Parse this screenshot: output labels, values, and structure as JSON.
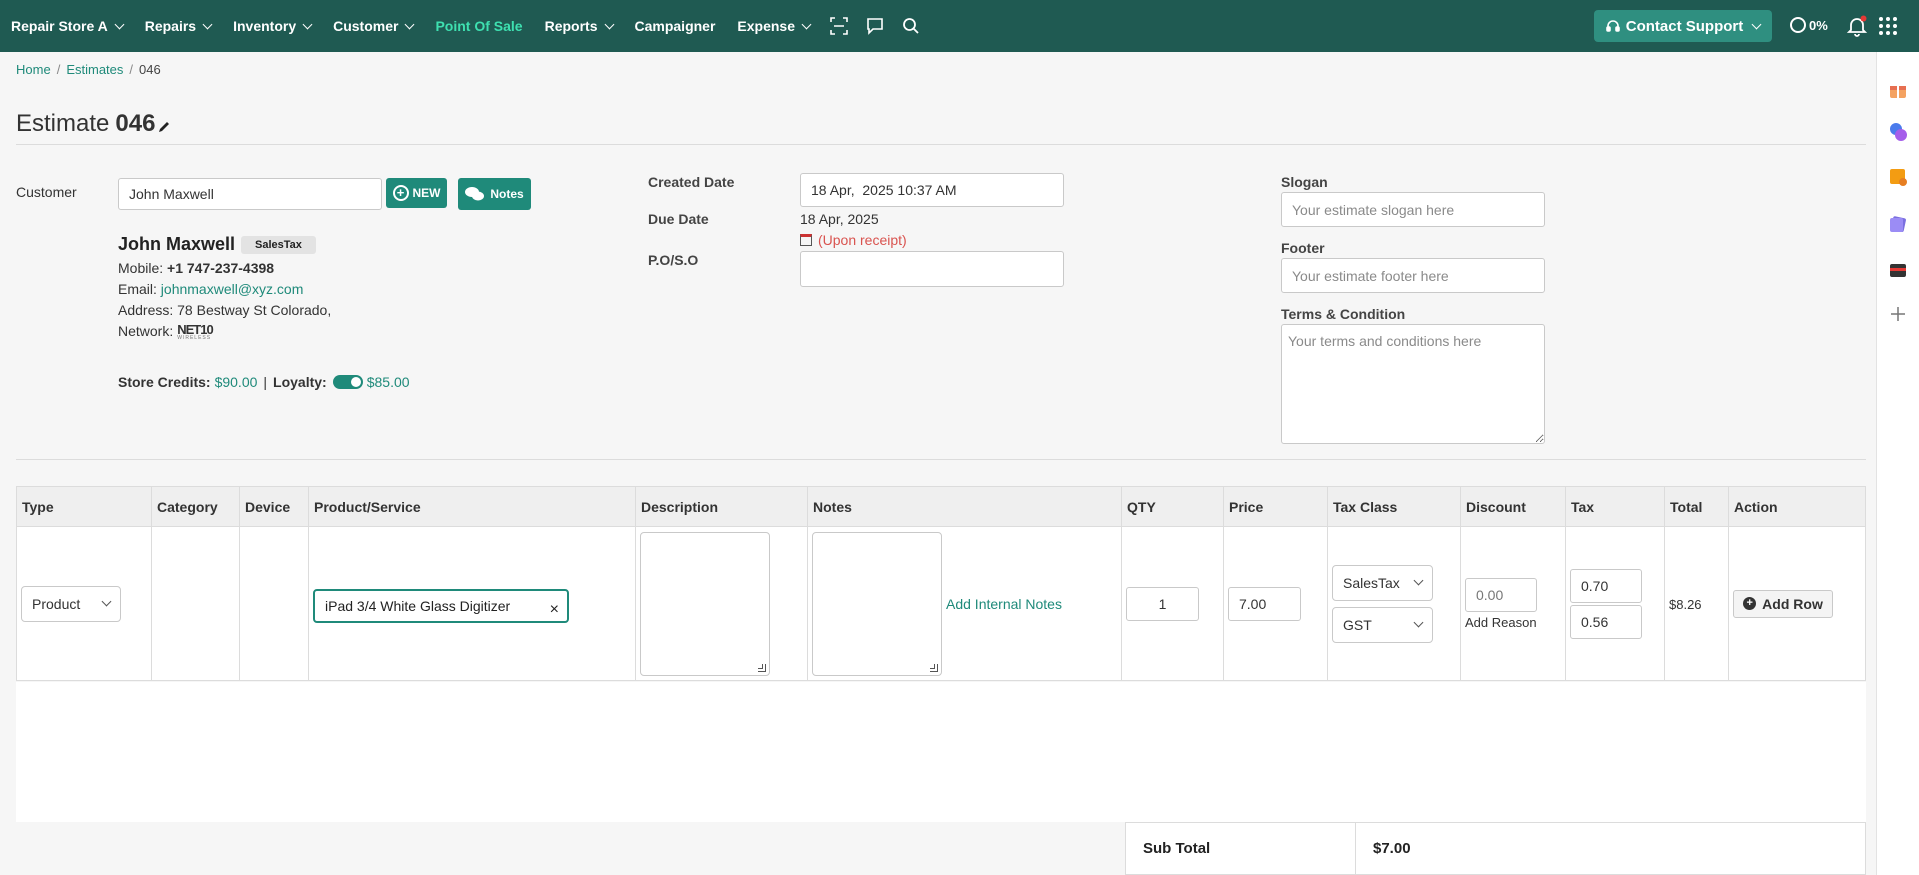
{
  "topnav": {
    "items": [
      {
        "label": "Repair Store A",
        "dropdown": true
      },
      {
        "label": "Repairs",
        "dropdown": true
      },
      {
        "label": "Inventory",
        "dropdown": true
      },
      {
        "label": "Customer",
        "dropdown": true
      },
      {
        "label": "Point Of Sale",
        "dropdown": false,
        "active": true
      },
      {
        "label": "Reports",
        "dropdown": true
      },
      {
        "label": "Campaigner",
        "dropdown": false
      },
      {
        "label": "Expense",
        "dropdown": true
      }
    ],
    "support_label": "Contact Support",
    "progress_label": "0%",
    "colors": {
      "bar": "#1f5a52",
      "accent": "#1f8a7a",
      "active": "#3ee0b0"
    }
  },
  "breadcrumb": {
    "home": "Home",
    "estimates": "Estimates",
    "current": "046"
  },
  "page": {
    "title": "Estimate",
    "number": "046"
  },
  "customer": {
    "label": "Customer",
    "input_value": "John Maxwell",
    "new_label": "NEW",
    "notes_label": "Notes",
    "name": "John Maxwell",
    "tax_badge": "SalesTax",
    "mobile_label": "Mobile:",
    "mobile": "+1 747-237-4398",
    "email_label": "Email:",
    "email": "johnmaxwell@xyz.com",
    "address_label": "Address:",
    "address": "78 Bestway St Colorado,",
    "network_label": "Network:",
    "network_logo": "NET10",
    "network_logo_sub": "WIRELESS",
    "store_credits_label": "Store Credits:",
    "store_credits": "$90.00",
    "loyalty_label": "Loyalty:",
    "loyalty": "$85.00"
  },
  "dates": {
    "created_label": "Created Date",
    "created_value": "18 Apr,  2025 10:37 AM",
    "due_label": "Due Date",
    "due_value": "18 Apr, 2025",
    "due_note": "(Upon receipt)",
    "po_label": "P.O/S.O",
    "po_value": ""
  },
  "extras": {
    "slogan_label": "Slogan",
    "slogan_placeholder": "Your estimate slogan here",
    "footer_label": "Footer",
    "footer_placeholder": "Your estimate footer here",
    "terms_label": "Terms & Condition",
    "terms_placeholder": "Your terms and conditions here"
  },
  "table": {
    "headers": [
      "Type",
      "Category",
      "Device",
      "Product/Service",
      "Description",
      "Notes",
      "QTY",
      "Price",
      "Tax Class",
      "Discount",
      "Tax",
      "Total",
      "Action"
    ],
    "row": {
      "type": "Product",
      "product": "iPad 3/4 White Glass Digitizer",
      "internal_notes_link": "Add Internal Notes",
      "qty": "1",
      "price": "7.00",
      "tax_class_1": "SalesTax",
      "tax_class_2": "GST",
      "discount": "0.00",
      "add_reason": "Add Reason",
      "tax_1": "0.70",
      "tax_2": "0.56",
      "total": "$8.26",
      "add_row": "Add Row"
    }
  },
  "summary": {
    "subtotal_label": "Sub Total",
    "subtotal_value": "$7.00"
  }
}
